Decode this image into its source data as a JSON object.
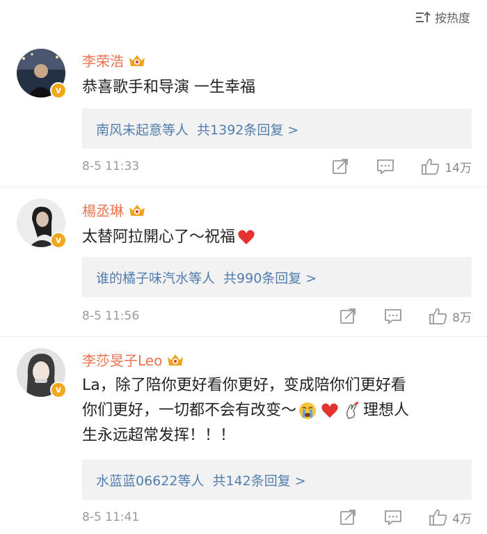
{
  "sort": {
    "label": "按热度",
    "icon": "sort-lines-icon"
  },
  "comments": [
    {
      "username": "李荣浩",
      "text": "恭喜歌手和导演 一生幸福",
      "reply": {
        "users": "南风未起意等人",
        "count_text": "共1392条回复 >"
      },
      "time": "8-5 11:33",
      "likes": "14万",
      "avatar_colors": [
        "#2a3140",
        "#7d8799"
      ]
    },
    {
      "username": "楊丞琳",
      "text": "太替阿拉開心了～祝福",
      "emoji": "red-heart-icon",
      "reply": {
        "users": "谁的橘子味汽水等人",
        "count_text": "共990条回复 >"
      },
      "time": "8-5 11:56",
      "likes": "8万",
      "avatar_colors": [
        "#e6e6e6",
        "#222222"
      ]
    },
    {
      "username": "李莎旻子Leo",
      "text_line1": "La，除了陪你更好看你更好，变成陪你们更好看",
      "text_line2_a": "你们更好，一切都不会有改变～",
      "text_line2_b": "理想人",
      "text_line3": "生永远超常发挥！！！",
      "emojis": [
        "crying-face-icon",
        "red-heart-icon",
        "finger-heart-icon"
      ],
      "reply": {
        "users": "水蓝蓝06622等人",
        "count_text": "共142条回复 >"
      },
      "time": "8-5 11:41",
      "likes": "4万",
      "avatar_colors": [
        "#dcdcdc",
        "#3a3a3a"
      ]
    }
  ],
  "colors": {
    "username": "#eb7350",
    "reply_link": "#507daf",
    "verified_badge": "#f2a81d",
    "meta": "#999999"
  }
}
